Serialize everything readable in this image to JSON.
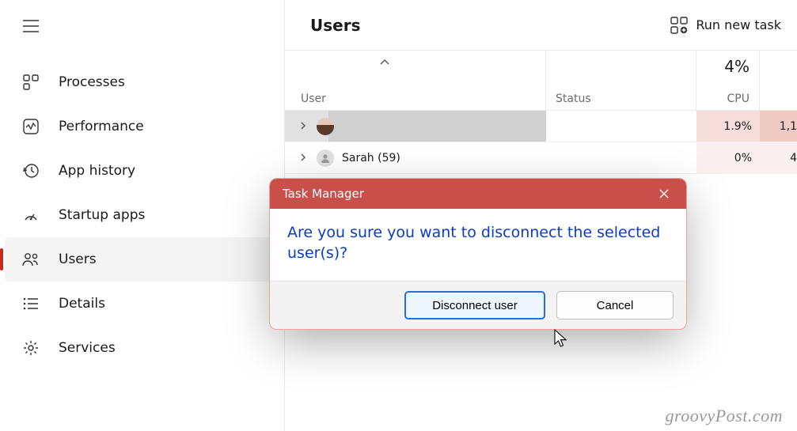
{
  "sidebar": {
    "items": [
      {
        "label": "Processes",
        "icon": "processes"
      },
      {
        "label": "Performance",
        "icon": "performance"
      },
      {
        "label": "App history",
        "icon": "history"
      },
      {
        "label": "Startup apps",
        "icon": "startup"
      },
      {
        "label": "Users",
        "icon": "users",
        "active": true
      },
      {
        "label": "Details",
        "icon": "details"
      },
      {
        "label": "Services",
        "icon": "services"
      }
    ]
  },
  "header": {
    "title": "Users",
    "run_new_task": "Run new task"
  },
  "columns": {
    "user": "User",
    "status": "Status",
    "cpu": "CPU",
    "cpu_total": "4%"
  },
  "rows": [
    {
      "name": "",
      "cpu": "1.9%",
      "mem": "1,1",
      "selected": true,
      "avatar": "photo"
    },
    {
      "name": "Sarah (59)",
      "cpu": "0%",
      "mem": "4",
      "selected": false,
      "avatar": "generic"
    }
  ],
  "dialog": {
    "title": "Task Manager",
    "message": "Are you sure you want to disconnect the selected user(s)?",
    "primary": "Disconnect user",
    "secondary": "Cancel"
  },
  "watermark": "groovyPost.com"
}
